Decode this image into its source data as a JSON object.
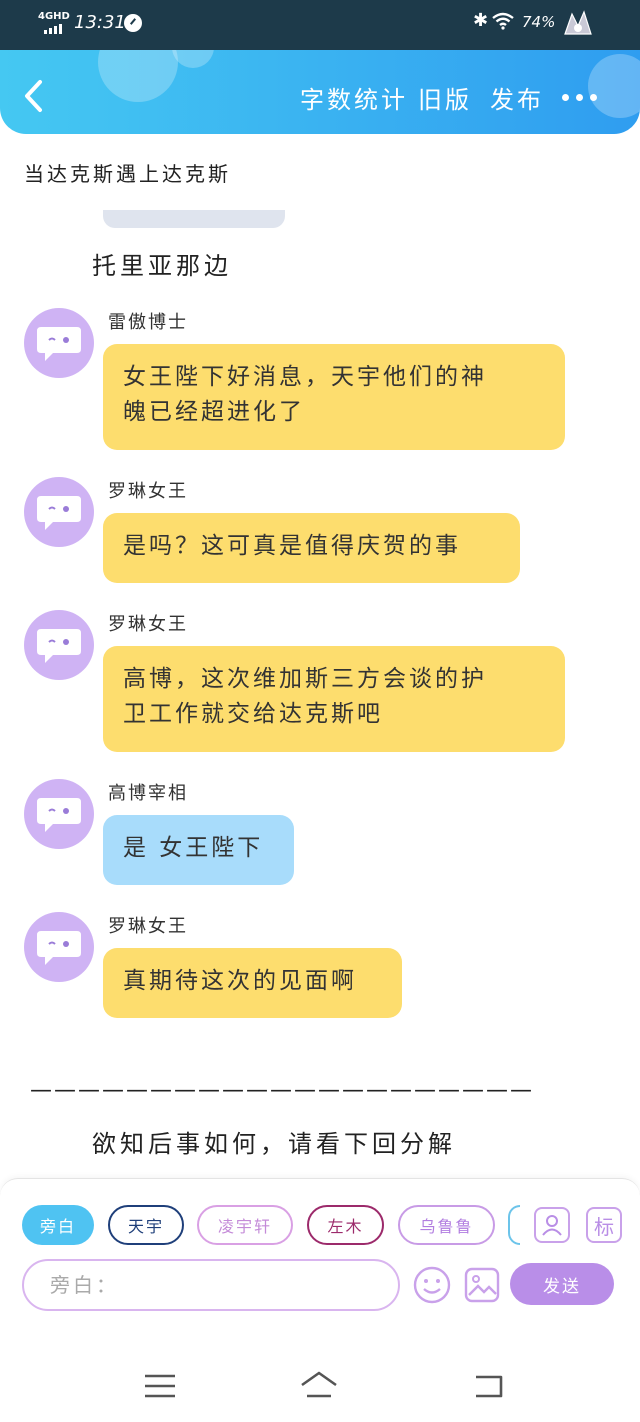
{
  "status_bar": {
    "network": "4GHD",
    "time": "13:31",
    "battery": "74%"
  },
  "header": {
    "word_count": "字数统计",
    "old_version": "旧版",
    "publish": "发布"
  },
  "story": {
    "title": "当达克斯遇上达克斯"
  },
  "narration_top": "托里亚那边",
  "messages": [
    {
      "speaker": "雷傲博士",
      "text_lines": [
        "女王陛下好消息，天宇他们的神",
        "魄已经超进化了"
      ],
      "color": "yellow"
    },
    {
      "speaker": "罗琳女王",
      "text_lines": [
        "是吗？这可真是值得庆贺的事"
      ],
      "color": "yellow"
    },
    {
      "speaker": "罗琳女王",
      "text_lines": [
        "高博，这次维加斯三方会谈的护",
        "卫工作就交给达克斯吧"
      ],
      "color": "yellow"
    },
    {
      "speaker": "高博宰相",
      "text_lines": [
        "是 女王陛下"
      ],
      "color": "blue"
    },
    {
      "speaker": "罗琳女王",
      "text_lines": [
        "真期待这次的见面啊"
      ],
      "color": "yellow"
    }
  ],
  "separator": "—————————————————————",
  "ending_text": "欲知后事如何，请看下回分解",
  "input_panel": {
    "characters": [
      "旁白",
      "天宇",
      "凌宇轩",
      "左木",
      "乌鲁鲁"
    ],
    "tag_button": "标",
    "input_placeholder": "旁白：",
    "send_label": "发送"
  },
  "colors": {
    "header_start": "#45c8f2",
    "header_end": "#2f9df0",
    "bubble_yellow": "#fddd6e",
    "bubble_blue": "#a8dcfb",
    "avatar": "#cfb3f4",
    "send": "#b98ee8"
  },
  "icons": [
    "back-arrow-icon",
    "more-dots-icon",
    "avatar-icon",
    "character-profile-icon",
    "emoji-icon",
    "image-icon",
    "menu-icon",
    "home-icon",
    "return-icon"
  ]
}
